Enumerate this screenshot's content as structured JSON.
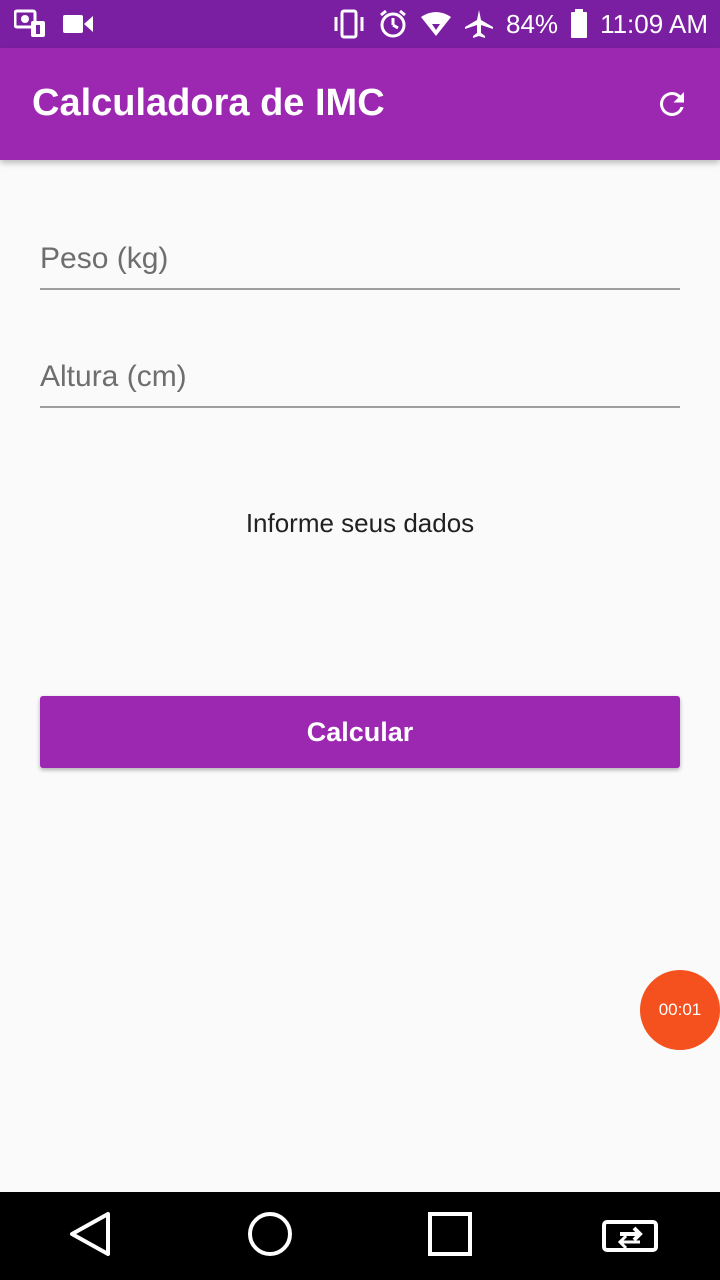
{
  "status_bar": {
    "battery": "84%",
    "time": "11:09 AM",
    "left_icons": [
      "wifi-assistant-icon",
      "video-camera-icon"
    ],
    "right_icons": [
      "vibrate-icon",
      "alarm-icon",
      "wifi-icon",
      "airplane-icon",
      "battery-icon"
    ]
  },
  "app_bar": {
    "title": "Calculadora de IMC",
    "action_icon": "refresh-icon"
  },
  "form": {
    "weight": {
      "placeholder": "Peso (kg)",
      "value": ""
    },
    "height": {
      "placeholder": "Altura (cm)",
      "value": ""
    }
  },
  "info_text": "Informe seus dados",
  "calc_button": "Calcular",
  "timer": "00:01",
  "nav_bar": {
    "icons": [
      "back-icon",
      "home-icon",
      "recents-icon",
      "rotate-screen-icon"
    ]
  },
  "colors": {
    "primary": "#9c27b0",
    "primary_dark": "#7b1fa2",
    "timer": "#f4511e"
  }
}
